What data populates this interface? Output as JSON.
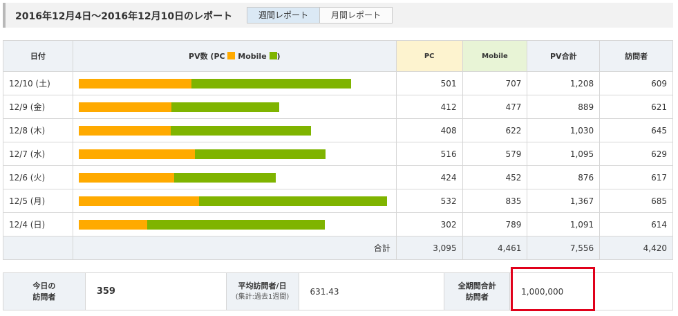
{
  "header": {
    "title": "2016年12月4日～2016年12月10日のレポート",
    "tabs": [
      {
        "label": "週間レポート",
        "active": true
      },
      {
        "label": "月間レポート",
        "active": false
      }
    ]
  },
  "table": {
    "headers": {
      "date": "日付",
      "pv_prefix": "PV数 (PC",
      "pv_mobile": "Mobile",
      "pv_suffix": ")",
      "pc": "PC",
      "mobile": "Mobile",
      "pv_total": "PV合計",
      "visitors": "訪問者"
    },
    "colors": {
      "pc": "#ffaa00",
      "mobile": "#7fb400",
      "highlight": "#e0001a"
    },
    "rows": [
      {
        "date": "12/10 (土)",
        "pc": 501,
        "mobile": 707,
        "total": "1,208",
        "visitors": "609"
      },
      {
        "date": "12/9 (金)",
        "pc": 412,
        "mobile": 477,
        "total": "889",
        "visitors": "621"
      },
      {
        "date": "12/8 (木)",
        "pc": 408,
        "mobile": 622,
        "total": "1,030",
        "visitors": "645"
      },
      {
        "date": "12/7 (水)",
        "pc": 516,
        "mobile": 579,
        "total": "1,095",
        "visitors": "629"
      },
      {
        "date": "12/6 (火)",
        "pc": 424,
        "mobile": 452,
        "total": "876",
        "visitors": "617"
      },
      {
        "date": "12/5 (月)",
        "pc": 532,
        "mobile": 835,
        "total": "1,367",
        "visitors": "685"
      },
      {
        "date": "12/4 (日)",
        "pc": 302,
        "mobile": 789,
        "total": "1,091",
        "visitors": "614"
      }
    ],
    "total": {
      "label": "合計",
      "pc": "3,095",
      "mobile": "4,461",
      "pv_total": "7,556",
      "visitors": "4,420"
    }
  },
  "summary": {
    "today_label_1": "今日の",
    "today_label_2": "訪問者",
    "today_value": "359",
    "avg_label_1": "平均訪問者/日",
    "avg_label_2": "(集計:過去1週間)",
    "avg_value": "631.43",
    "alltime_label_1": "全期間合計",
    "alltime_label_2": "訪問者",
    "alltime_value": "1,000,000"
  }
}
